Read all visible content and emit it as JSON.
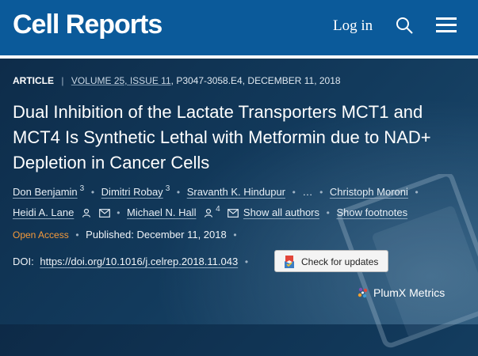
{
  "header": {
    "logo": "Cell Reports",
    "login_label": "Log in",
    "search_icon": "search-icon",
    "menu_icon": "hamburger-menu-icon"
  },
  "article": {
    "type": "ARTICLE",
    "volume_info": "VOLUME 25, ISSUE 11",
    "pages_date": "P3047-3058.E4, DECEMBER 11, 2018",
    "title": "Dual Inhibition of the Lactate Transporters MCT1 and MCT4 Is Synthetic Lethal with Metformin due to NAD+ Depletion in Cancer Cells"
  },
  "authors": {
    "a1": "Don Benjamin",
    "a1_sup": "3",
    "a2": "Dimitri Robay",
    "a2_sup": "3",
    "a3": "Sravanth K. Hindupur",
    "ellipsis": "…",
    "a4": "Christoph Moroni",
    "a5": "Heidi A. Lane",
    "a6": "Michael N. Hall",
    "a6_sup": "4",
    "show_all": "Show all authors",
    "show_footnotes": "Show footnotes"
  },
  "publication": {
    "open_access": "Open Access",
    "published": "Published: December 11, 2018"
  },
  "doi": {
    "label": "DOI:",
    "link": "https://doi.org/10.1016/j.celrep.2018.11.043",
    "check_updates": "Check for updates"
  },
  "plumx": {
    "label": "PlumX Metrics"
  },
  "colors": {
    "header_bg": "#0b5a9a",
    "page_bg": "#123a5c",
    "open_access": "#f59a3a"
  }
}
